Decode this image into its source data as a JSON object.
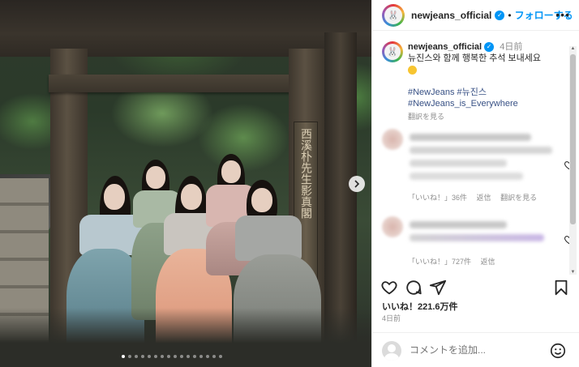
{
  "photo": {
    "plaque_text": "西溪朴先生影真閣",
    "carousel": {
      "count": 16,
      "active_index": 0
    }
  },
  "header": {
    "username": "newjeans_official",
    "separator": "•",
    "follow_label": "フォローする",
    "more_label": "•••",
    "avatar_glyph": "🐰"
  },
  "caption": {
    "username": "newjeans_official",
    "time_ago": "4日前",
    "text": "뉴진스와 함께 행복한 추석 보내세요",
    "hashtag_1": "#NewJeans",
    "hashtag_2": "#뉴진스",
    "hashtag_3": "#NewJeans_is_Everywhere",
    "translate_label": "翻訳を見る"
  },
  "comments": [
    {
      "likes": "「いいね！」36件",
      "reply": "返信",
      "translate": "翻訳を見る"
    },
    {
      "likes": "「いいね！」727件",
      "reply": "返信"
    }
  ],
  "icons": {
    "like": "heart-icon",
    "comment": "comment-icon",
    "share": "share-icon",
    "save": "bookmark-icon",
    "emoji": "smiley-icon"
  },
  "stats": {
    "likes": "いいね！221.6万件",
    "posted": "4日前"
  },
  "add_comment": {
    "placeholder": "コメントを追加..."
  },
  "colors": {
    "accent": "#0095f6",
    "hashtag": "#385185",
    "muted": "#8e8e8e",
    "text": "#262626"
  }
}
